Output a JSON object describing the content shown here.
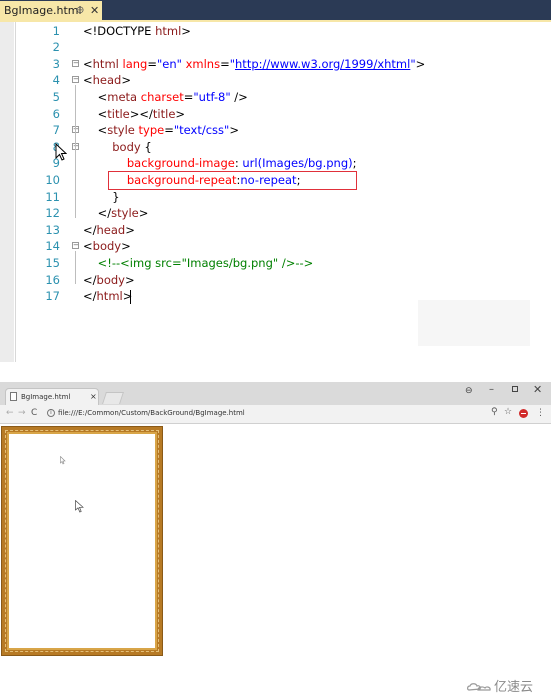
{
  "editor": {
    "tab_label": "BgImage.html",
    "tab_pin": "⊕",
    "tab_close": "✕",
    "highlighted_line": 10,
    "lines": [
      {
        "n": "1",
        "parts": [
          [
            "c-text",
            "<!DOCTYPE "
          ],
          [
            "c-tag",
            "html"
          ],
          [
            "c-text",
            ">"
          ]
        ]
      },
      {
        "n": "2",
        "parts": []
      },
      {
        "n": "3",
        "parts": [
          [
            "c-text",
            "<"
          ],
          [
            "c-tag",
            "html"
          ],
          [
            "c-attr",
            " lang"
          ],
          [
            "c-text",
            "="
          ],
          [
            "c-val",
            "\"en\""
          ],
          [
            "c-attr",
            " xmlns"
          ],
          [
            "c-text",
            "="
          ],
          [
            "c-val",
            "\""
          ],
          [
            "c-link",
            "http://www.w3.org/1999/xhtml"
          ],
          [
            "c-val",
            "\""
          ],
          [
            "c-text",
            ">"
          ]
        ]
      },
      {
        "n": "4",
        "parts": [
          [
            "c-text",
            "<"
          ],
          [
            "c-tag",
            "head"
          ],
          [
            "c-text",
            ">"
          ]
        ]
      },
      {
        "n": "5",
        "parts": [
          [
            "c-text",
            "    <"
          ],
          [
            "c-tag",
            "meta"
          ],
          [
            "c-attr",
            " charset"
          ],
          [
            "c-text",
            "="
          ],
          [
            "c-val",
            "\"utf-8\""
          ],
          [
            "c-text",
            " />"
          ]
        ]
      },
      {
        "n": "6",
        "parts": [
          [
            "c-text",
            "    <"
          ],
          [
            "c-tag",
            "title"
          ],
          [
            "c-text",
            "></"
          ],
          [
            "c-tag",
            "title"
          ],
          [
            "c-text",
            ">"
          ]
        ]
      },
      {
        "n": "7",
        "parts": [
          [
            "c-text",
            "    <"
          ],
          [
            "c-tag",
            "style"
          ],
          [
            "c-attr",
            " type"
          ],
          [
            "c-text",
            "="
          ],
          [
            "c-val",
            "\"text/css\""
          ],
          [
            "c-text",
            ">"
          ]
        ]
      },
      {
        "n": "8",
        "parts": [
          [
            "c-tag",
            "        body"
          ],
          [
            "c-text",
            " {"
          ]
        ]
      },
      {
        "n": "9",
        "parts": [
          [
            "c-css-prop",
            "            background-image"
          ],
          [
            "c-text",
            ": "
          ],
          [
            "c-css-val",
            "url(Images/bg.png)"
          ],
          [
            "c-text",
            ";"
          ]
        ]
      },
      {
        "n": "10",
        "parts": [
          [
            "c-css-prop",
            "            background-repeat"
          ],
          [
            "c-text",
            ":"
          ],
          [
            "c-css-val",
            "no-repeat"
          ],
          [
            "c-text",
            ";"
          ]
        ]
      },
      {
        "n": "11",
        "parts": [
          [
            "c-text",
            "        }"
          ]
        ]
      },
      {
        "n": "12",
        "parts": [
          [
            "c-text",
            "    </"
          ],
          [
            "c-tag",
            "style"
          ],
          [
            "c-text",
            ">"
          ]
        ]
      },
      {
        "n": "13",
        "parts": [
          [
            "c-text",
            "</"
          ],
          [
            "c-tag",
            "head"
          ],
          [
            "c-text",
            ">"
          ]
        ]
      },
      {
        "n": "14",
        "parts": [
          [
            "c-text",
            "<"
          ],
          [
            "c-tag",
            "body"
          ],
          [
            "c-text",
            ">"
          ]
        ]
      },
      {
        "n": "15",
        "parts": [
          [
            "c-comment",
            "    <!--<img src=\"Images/bg.png\" />-->"
          ]
        ]
      },
      {
        "n": "16",
        "parts": [
          [
            "c-text",
            "</"
          ],
          [
            "c-tag",
            "body"
          ],
          [
            "c-text",
            ">"
          ]
        ]
      },
      {
        "n": "17",
        "parts": [
          [
            "c-text",
            "</"
          ],
          [
            "c-tag",
            "html"
          ],
          [
            "c-text",
            ">"
          ]
        ]
      }
    ],
    "fold_markers": [
      "3",
      "4",
      "7",
      "8",
      "14"
    ]
  },
  "browser": {
    "tab_title": "BgImage.html",
    "tab_close": "×",
    "nav_back": "←",
    "nav_forward": "→",
    "nav_reload": "C",
    "url": "file:///E:/Common/Custom/BackGround/BgImage.html",
    "window_controls": {
      "profile": "⊖",
      "minimize": "–",
      "close": "✕"
    },
    "icons": {
      "zoom": "⚲",
      "star": "☆",
      "menu": "⋮"
    },
    "frame_color": "#b77a25"
  },
  "watermark": {
    "text": "亿速云"
  }
}
